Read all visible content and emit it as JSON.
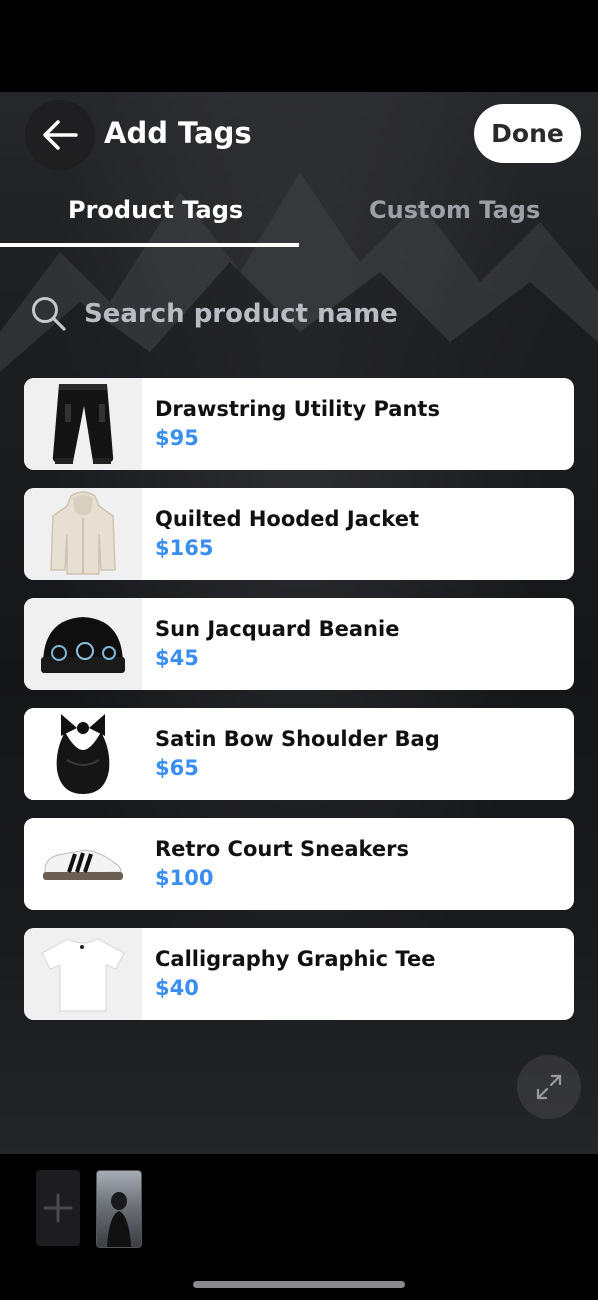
{
  "header": {
    "back_icon": "arrow-left-icon",
    "title": "Add Tags",
    "done_label": "Done"
  },
  "tabs": [
    {
      "label": "Product Tags",
      "active": true
    },
    {
      "label": "Custom Tags",
      "active": false
    }
  ],
  "search": {
    "icon": "search-icon",
    "placeholder": "Search product name",
    "value": ""
  },
  "products": [
    {
      "name": "Drawstring Utility Pants",
      "price": "$95",
      "thumb_icon": "pants-icon"
    },
    {
      "name": "Quilted Hooded Jacket",
      "price": "$165",
      "thumb_icon": "jacket-icon"
    },
    {
      "name": "Sun Jacquard Beanie",
      "price": "$45",
      "thumb_icon": "beanie-icon"
    },
    {
      "name": "Satin Bow Shoulder Bag",
      "price": "$65",
      "thumb_icon": "bag-icon"
    },
    {
      "name": "Retro Court Sneakers",
      "price": "$100",
      "thumb_icon": "sneaker-icon"
    },
    {
      "name": "Calligraphy Graphic Tee",
      "price": "$40",
      "thumb_icon": "tshirt-icon"
    }
  ],
  "colors": {
    "price": "#3a8ef0",
    "card": "#ffffff",
    "active_tab": "#ffffff",
    "inactive_tab": "#9da0a6"
  },
  "bottom": {
    "add_icon": "plus-icon",
    "expand_icon": "expand-icon"
  }
}
